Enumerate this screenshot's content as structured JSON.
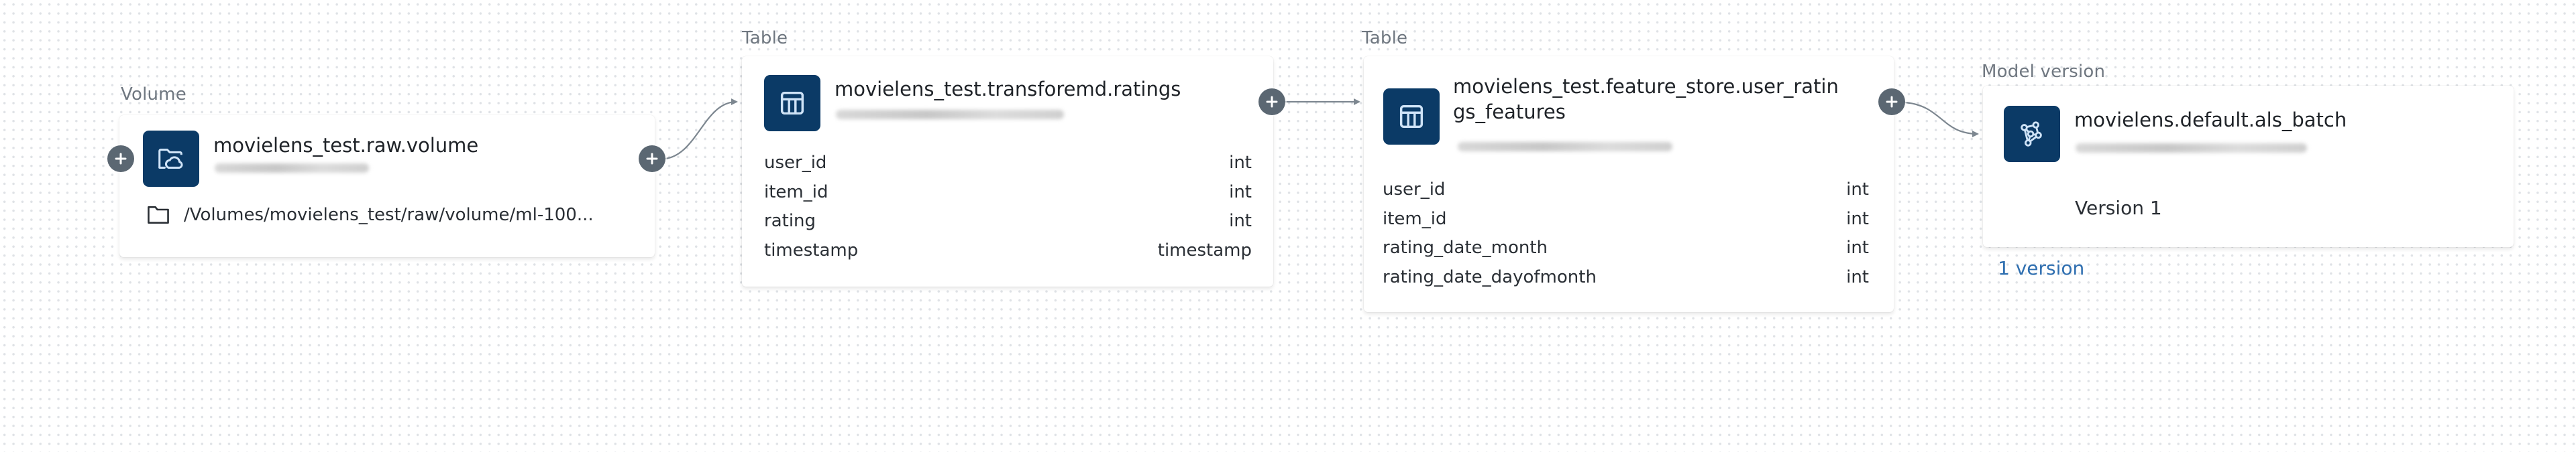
{
  "lineage": {
    "nodes": [
      {
        "type_label": "Volume",
        "title": "movielens_test.raw.volume",
        "icon": "folder-cloud-icon",
        "path_icon": "folder-icon",
        "path": "/Volumes/movielens_test/raw/volume/ml-100..."
      },
      {
        "type_label": "Table",
        "title": "movielens_test.transforemd.ratings",
        "icon": "table-icon",
        "columns": [
          {
            "name": "user_id",
            "type": "int"
          },
          {
            "name": "item_id",
            "type": "int"
          },
          {
            "name": "rating",
            "type": "int"
          },
          {
            "name": "timestamp",
            "type": "timestamp"
          }
        ]
      },
      {
        "type_label": "Table",
        "title_line1": "movielens_test.feature_store.user_ratin",
        "title_line2": "gs_features",
        "icon": "table-icon",
        "columns": [
          {
            "name": "user_id",
            "type": "int"
          },
          {
            "name": "item_id",
            "type": "int"
          },
          {
            "name": "rating_date_month",
            "type": "int"
          },
          {
            "name": "rating_date_dayofmonth",
            "type": "int"
          }
        ]
      },
      {
        "type_label": "Model version",
        "title": "movielens.default.als_batch",
        "icon": "model-graph-icon",
        "version": "Version 1",
        "versions_link": "1 version"
      }
    ],
    "colors": {
      "icon_bg": "#0b3a66",
      "expand_button": "#5b6772",
      "edge": "#7d8790",
      "link": "#2f6fb0"
    }
  }
}
